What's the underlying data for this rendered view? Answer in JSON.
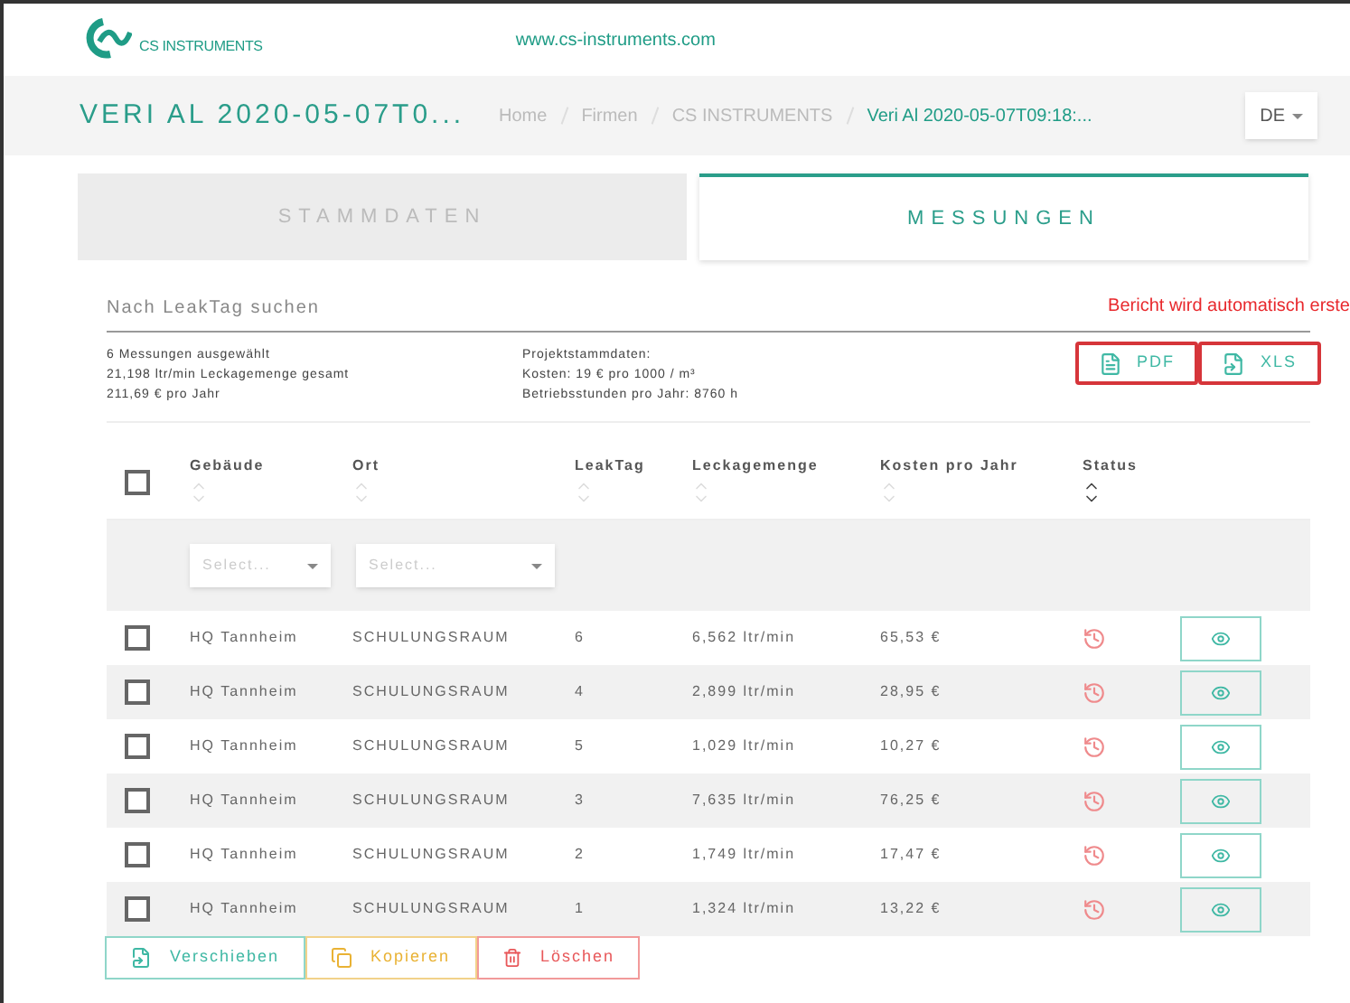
{
  "topbar": {
    "logo_text": "CS INSTRUMENTS",
    "url": "www.cs-instruments.com"
  },
  "header": {
    "title": "VERI AL 2020-05-07T0...",
    "breadcrumbs": [
      {
        "label": "Home",
        "selected": false
      },
      {
        "label": "Firmen",
        "selected": false
      },
      {
        "label": "CS INSTRUMENTS",
        "selected": false
      },
      {
        "label": "Veri Al 2020-05-07T09:18:...",
        "selected": true
      }
    ],
    "language": "DE"
  },
  "tabs": [
    {
      "label": "STAMMDATEN",
      "selected": false
    },
    {
      "label": "MESSUNGEN",
      "selected": true
    }
  ],
  "search": {
    "placeholder": "Nach LeakTag suchen"
  },
  "notice": "Bericht wird automatisch erste",
  "summary": [
    "6 Messungen ausgewählt",
    "21,198 ltr/min Leckagemenge gesamt",
    "211,69 € pro Jahr"
  ],
  "project": [
    "Projektstammdaten:",
    "Kosten: 19 € pro 1000 / m³",
    "Betriebsstunden pro Jahr: 8760 h"
  ],
  "exports": [
    {
      "label": "PDF",
      "kind": "pdf"
    },
    {
      "label": "XLS",
      "kind": "xls"
    }
  ],
  "table": {
    "columns": [
      "Gebäude",
      "Ort",
      "LeakTag",
      "Leckagemenge",
      "Kosten pro Jahr",
      "Status"
    ],
    "filters": [
      {
        "placeholder": "Select..."
      },
      {
        "placeholder": "Select..."
      }
    ],
    "all_checked": false,
    "rows": [
      {
        "checked": false,
        "cells": [
          "HQ Tannheim",
          "SCHULUNGSRAUM",
          "6",
          "6,562 ltr/min",
          "65,53 €"
        ]
      },
      {
        "checked": false,
        "cells": [
          "HQ Tannheim",
          "SCHULUNGSRAUM",
          "4",
          "2,899 ltr/min",
          "28,95 €"
        ]
      },
      {
        "checked": false,
        "cells": [
          "HQ Tannheim",
          "SCHULUNGSRAUM",
          "5",
          "1,029 ltr/min",
          "10,27 €"
        ]
      },
      {
        "checked": false,
        "cells": [
          "HQ Tannheim",
          "SCHULUNGSRAUM",
          "3",
          "7,635 ltr/min",
          "76,25 €"
        ]
      },
      {
        "checked": false,
        "cells": [
          "HQ Tannheim",
          "SCHULUNGSRAUM",
          "2",
          "1,749 ltr/min",
          "17,47 €"
        ]
      },
      {
        "checked": false,
        "cells": [
          "HQ Tannheim",
          "SCHULUNGSRAUM",
          "1",
          "1,324 ltr/min",
          "13,22 €"
        ]
      }
    ]
  },
  "actions": [
    {
      "label": "Verschieben",
      "kind": "move"
    },
    {
      "label": "Kopieren",
      "kind": "copy"
    },
    {
      "label": "Löschen",
      "kind": "delete"
    }
  ]
}
